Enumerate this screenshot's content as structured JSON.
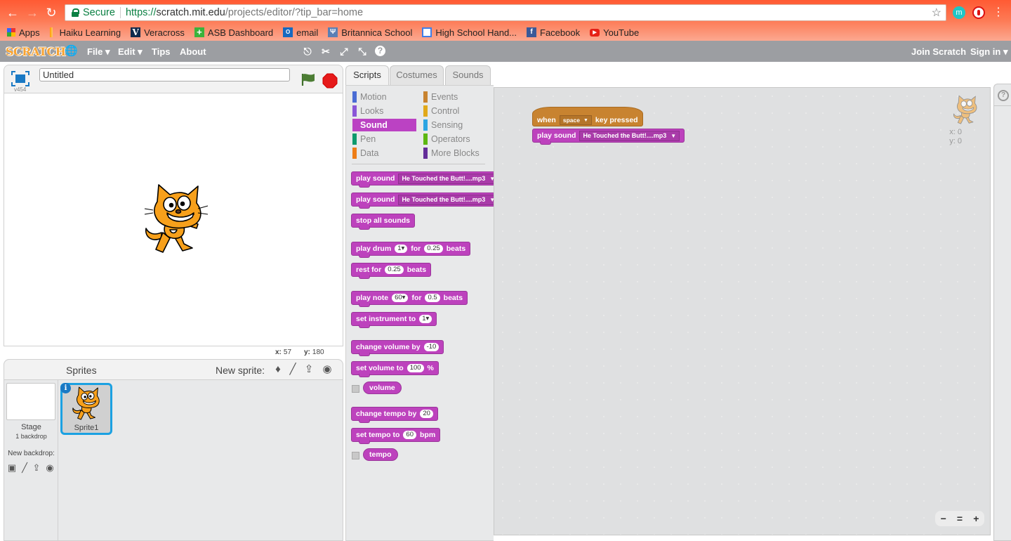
{
  "browser": {
    "secure_label": "Secure",
    "url_protocol": "https://",
    "url_host": "scratch.mit.edu",
    "url_path": "/projects/editor/?tip_bar=home",
    "extension_m": "m",
    "bookmarks": [
      {
        "label": "Apps",
        "icon": "apps-grid-icon"
      },
      {
        "label": "Haiku Learning",
        "icon": "haiku-icon"
      },
      {
        "label": "Veracross",
        "icon": "veracross-icon"
      },
      {
        "label": "ASB Dashboard",
        "icon": "plus-icon"
      },
      {
        "label": "email",
        "icon": "outlook-icon"
      },
      {
        "label": "Britannica School",
        "icon": "britannica-icon"
      },
      {
        "label": "High School Hand...",
        "icon": "doc-icon"
      },
      {
        "label": "Facebook",
        "icon": "facebook-icon"
      },
      {
        "label": "YouTube",
        "icon": "youtube-icon"
      }
    ]
  },
  "menubar": {
    "logo": "SCRATCH",
    "file": "File ▾",
    "edit": "Edit ▾",
    "tips": "Tips",
    "about": "About",
    "join": "Join Scratch",
    "signin": "Sign in ▾"
  },
  "stage": {
    "version": "v454",
    "project_title": "Untitled",
    "mouse_x_label": "x:",
    "mouse_x": "57",
    "mouse_y_label": "y:",
    "mouse_y": "180"
  },
  "sprites_panel": {
    "title": "Sprites",
    "new_sprite": "New sprite:",
    "stage_label": "Stage",
    "backdrop_count": "1 backdrop",
    "new_backdrop": "New backdrop:",
    "sprites": [
      {
        "name": "Sprite1",
        "selected": true
      }
    ]
  },
  "tabs": [
    {
      "label": "Scripts",
      "active": true
    },
    {
      "label": "Costumes",
      "active": false
    },
    {
      "label": "Sounds",
      "active": false
    }
  ],
  "categories": [
    {
      "label": "Motion",
      "color": "#4a6cd4"
    },
    {
      "label": "Looks",
      "color": "#8a55d7"
    },
    {
      "label": "Sound",
      "color": "#bb42c3",
      "selected": true
    },
    {
      "label": "Pen",
      "color": "#0e9a6c"
    },
    {
      "label": "Data",
      "color": "#ee7d16"
    },
    {
      "label": "Events",
      "color": "#c88330"
    },
    {
      "label": "Control",
      "color": "#e1a91a"
    },
    {
      "label": "Sensing",
      "color": "#2ca5e2"
    },
    {
      "label": "Operators",
      "color": "#5cb712"
    },
    {
      "label": "More Blocks",
      "color": "#632d99"
    }
  ],
  "palette": {
    "play_sound": "play sound",
    "sound_name": "He Touched the Butt!....mp3",
    "stop_all": "stop all sounds",
    "play_drum": "play drum",
    "drum_val": "1",
    "for": "for",
    "beats": "beats",
    "drum_beats": "0.25",
    "rest_for": "rest for",
    "rest_beats": "0.25",
    "play_note": "play note",
    "note_val": "60",
    "note_beats": "0.5",
    "set_instrument": "set instrument to",
    "instrument_val": "1",
    "change_volume": "change volume by",
    "volume_delta": "-10",
    "set_volume": "set volume to",
    "volume_val": "100",
    "percent": "%",
    "volume_reporter": "volume",
    "change_tempo": "change tempo by",
    "tempo_delta": "20",
    "set_tempo": "set tempo to",
    "tempo_val": "60",
    "bpm": "bpm",
    "tempo_reporter": "tempo"
  },
  "workspace": {
    "hat_when": "when",
    "hat_key": "space",
    "hat_rest": "key pressed",
    "play_sound": "play sound",
    "sound_name": "He Touched the Butt!....mp3",
    "sprite_x": "x: 0",
    "sprite_y": "y: 0",
    "zoom_out": "−",
    "zoom_reset": "=",
    "zoom_in": "+"
  },
  "help": "?"
}
